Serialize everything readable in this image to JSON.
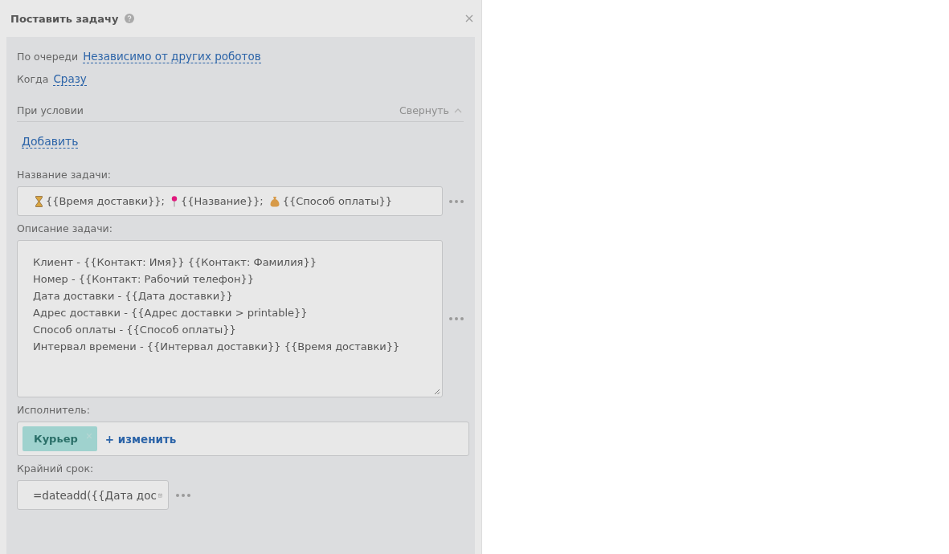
{
  "window": {
    "title": "Поставить задачу"
  },
  "queue": {
    "label": "По очереди",
    "value": "Независимо от других роботов"
  },
  "when": {
    "label": "Когда",
    "value": "Сразу"
  },
  "condition": {
    "label": "При условии",
    "toggle": "Свернуть",
    "expanded": true,
    "add": "Добавить"
  },
  "task_title": {
    "label": "Название задачи:",
    "pieces": [
      {
        "kind": "hourglass",
        "text": "{{Время доставки}};"
      },
      {
        "kind": "pin",
        "text": "{{Название}};"
      },
      {
        "kind": "moneybag",
        "text": "{{Способ оплаты}}"
      }
    ]
  },
  "description": {
    "label": "Описание задачи:",
    "lines": [
      "Клиент - {{Контакт: Имя}} {{Контакт: Фамилия}}",
      "Номер - {{Контакт: Рабочий телефон}}",
      "Дата доставки - {{Дата доставки}}",
      "Адрес доставки - {{Адрес доставки > printable}}",
      "Способ оплаты - {{Способ оплаты}}",
      "Интервал времени - {{Интервал доставки}} {{Время доставки}}"
    ]
  },
  "assignee": {
    "label": "Исполнитель:",
    "tags": [
      "Курьер"
    ],
    "change": "+ изменить"
  },
  "deadline": {
    "label": "Крайний срок:",
    "value": "=dateadd({{Дата дос"
  }
}
